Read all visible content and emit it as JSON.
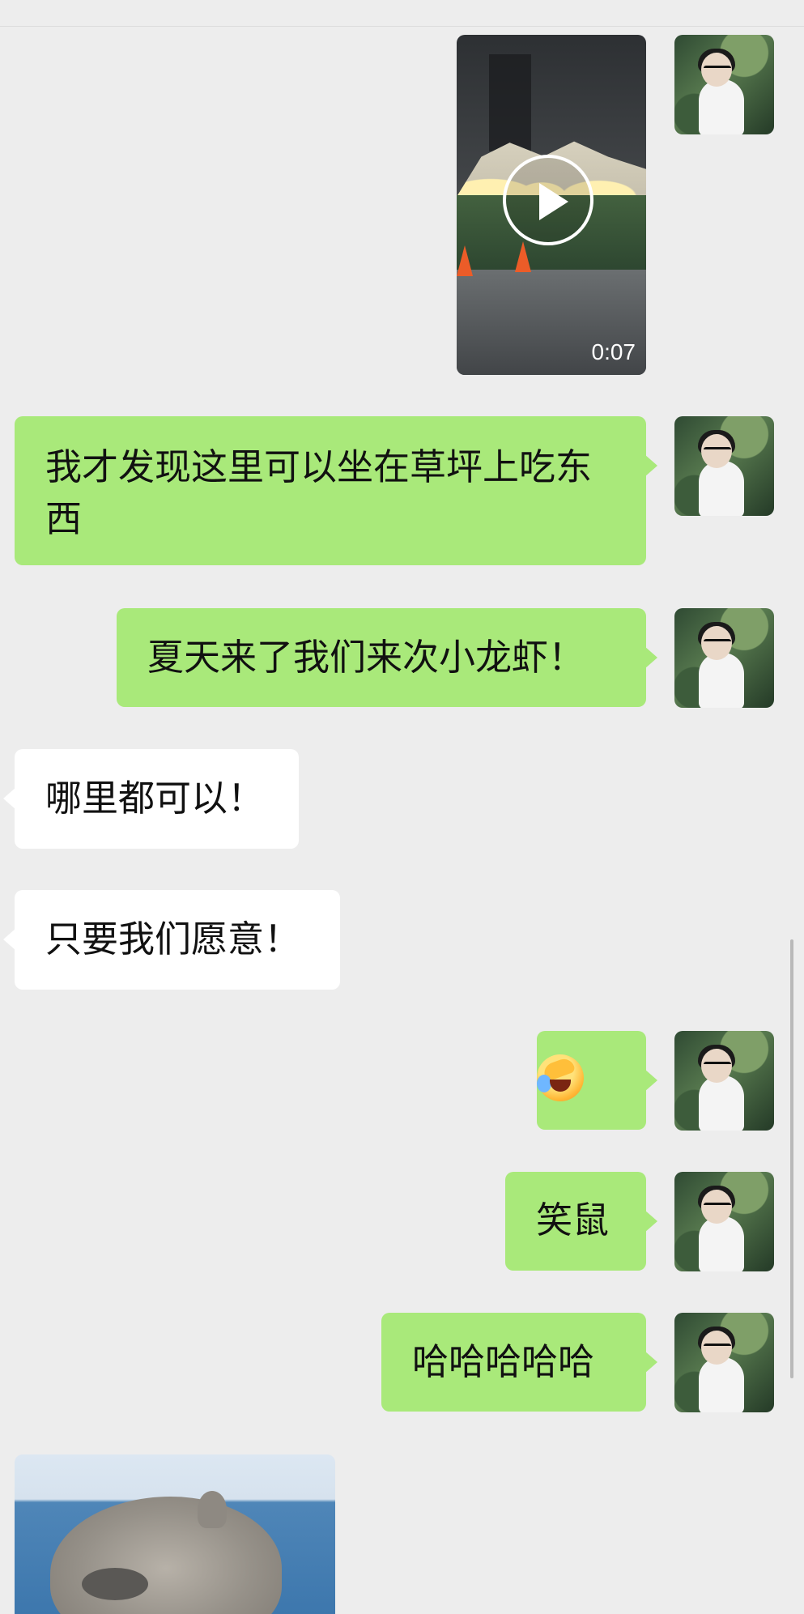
{
  "conversation": {
    "video": {
      "duration": "0:07"
    },
    "messages": [
      {
        "side": "right",
        "type": "text",
        "text": "我才发现这里可以坐在草坪上吃东西"
      },
      {
        "side": "right",
        "type": "text",
        "text": "夏天来了我们来次小龙虾！"
      },
      {
        "side": "left",
        "type": "text",
        "text": "哪里都可以！"
      },
      {
        "side": "left",
        "type": "text",
        "text": "只要我们愿意！"
      },
      {
        "side": "right",
        "type": "emoji",
        "emoji": "face-holding-back-tears-emoji"
      },
      {
        "side": "right",
        "type": "text",
        "text": "笑鼠"
      },
      {
        "side": "right",
        "type": "text",
        "text": "哈哈哈哈哈"
      }
    ],
    "incoming_image": {
      "subject": "otter"
    }
  },
  "icons": {
    "play": "play-icon",
    "avatar": "avatar-icon",
    "scrollbar": "scrollbar"
  }
}
